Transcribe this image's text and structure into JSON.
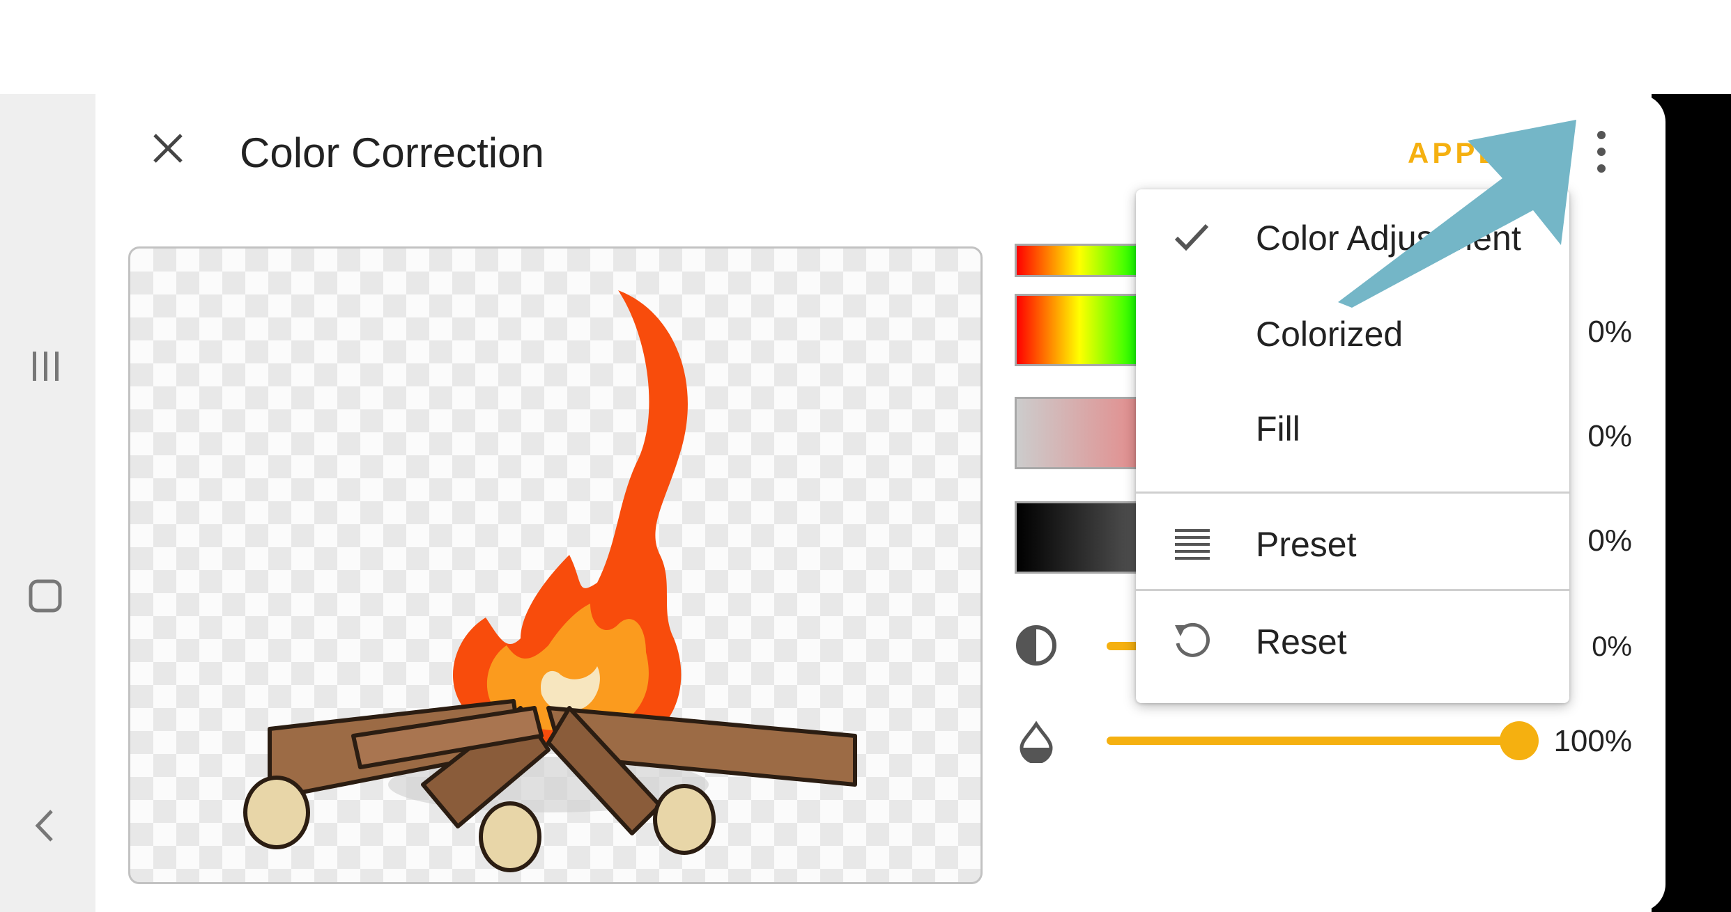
{
  "dialog": {
    "title": "Color Correction",
    "apply_label": "APPLY"
  },
  "icons": {
    "close": "close-icon",
    "more": "more-vert-icon",
    "nav_recents": "recent-apps-icon",
    "nav_home": "home-icon",
    "nav_back": "back-icon",
    "contrast": "contrast-icon",
    "opacity": "opacity-drop-icon",
    "check": "check-icon",
    "preset": "list-icon",
    "reset": "reset-icon"
  },
  "adjustments": {
    "hue_pct": "0%",
    "saturation_pct": "0%",
    "brightness_pct": "0%",
    "contrast_pct": "0%",
    "opacity_pct": "100%",
    "contrast_value": 0,
    "opacity_value": 1.0
  },
  "menu": {
    "items": [
      {
        "label": "Color Adjustment",
        "checked": true
      },
      {
        "label": "Colorized",
        "checked": false
      },
      {
        "label": "Fill",
        "checked": false
      },
      {
        "label": "Preset"
      },
      {
        "label": "Reset"
      }
    ]
  },
  "colors": {
    "accent": "#f5b010",
    "arrow": "#74b6c7"
  }
}
